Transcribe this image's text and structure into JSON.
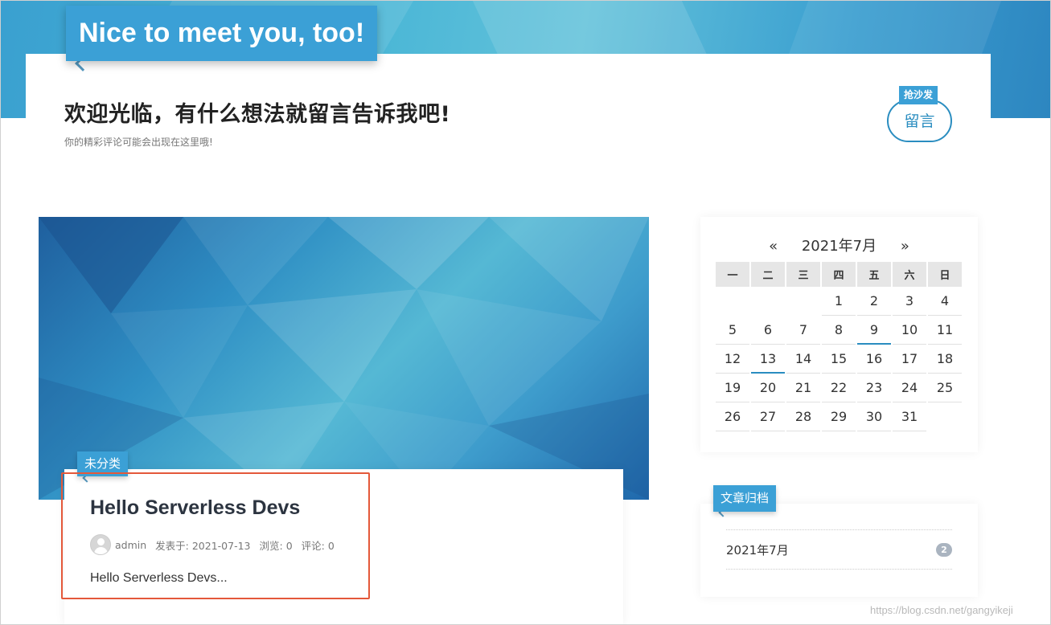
{
  "site": {
    "title": "Nice to meet you, too!"
  },
  "header": {
    "welcome_title": "欢迎光临，有什么想法就留言告诉我吧!",
    "welcome_subtitle": "你的精彩评论可能会出现在这里哦!",
    "message_badge": "抢沙发",
    "message_button": "留言"
  },
  "post": {
    "category": "未分类",
    "title": "Hello Serverless Devs",
    "author": "admin",
    "date_label": "发表于: 2021-07-13",
    "views_label": "浏览: 0",
    "comments_label": "评论: 0",
    "excerpt": "Hello Serverless Devs..."
  },
  "calendar": {
    "prev": "«",
    "month_label": "2021年7月",
    "next": "»",
    "weekdays": [
      "一",
      "二",
      "三",
      "四",
      "五",
      "六",
      "日"
    ],
    "weeks": [
      [
        "",
        "",
        "",
        "1",
        "2",
        "3",
        "4"
      ],
      [
        "5",
        "6",
        "7",
        "8",
        "9",
        "10",
        "11"
      ],
      [
        "12",
        "13",
        "14",
        "15",
        "16",
        "17",
        "18"
      ],
      [
        "19",
        "20",
        "21",
        "22",
        "23",
        "24",
        "25"
      ],
      [
        "26",
        "27",
        "28",
        "29",
        "30",
        "31",
        ""
      ]
    ],
    "highlighted_days": [
      "9",
      "13"
    ]
  },
  "archive": {
    "title": "文章归档",
    "items": [
      {
        "label": "2021年7月",
        "count": "2"
      }
    ]
  },
  "watermark": "https://blog.csdn.net/gangyikeji",
  "colors": {
    "accent": "#3ba0d6",
    "highlight_box": "#e4583a",
    "button_border": "#2a8dc0"
  }
}
